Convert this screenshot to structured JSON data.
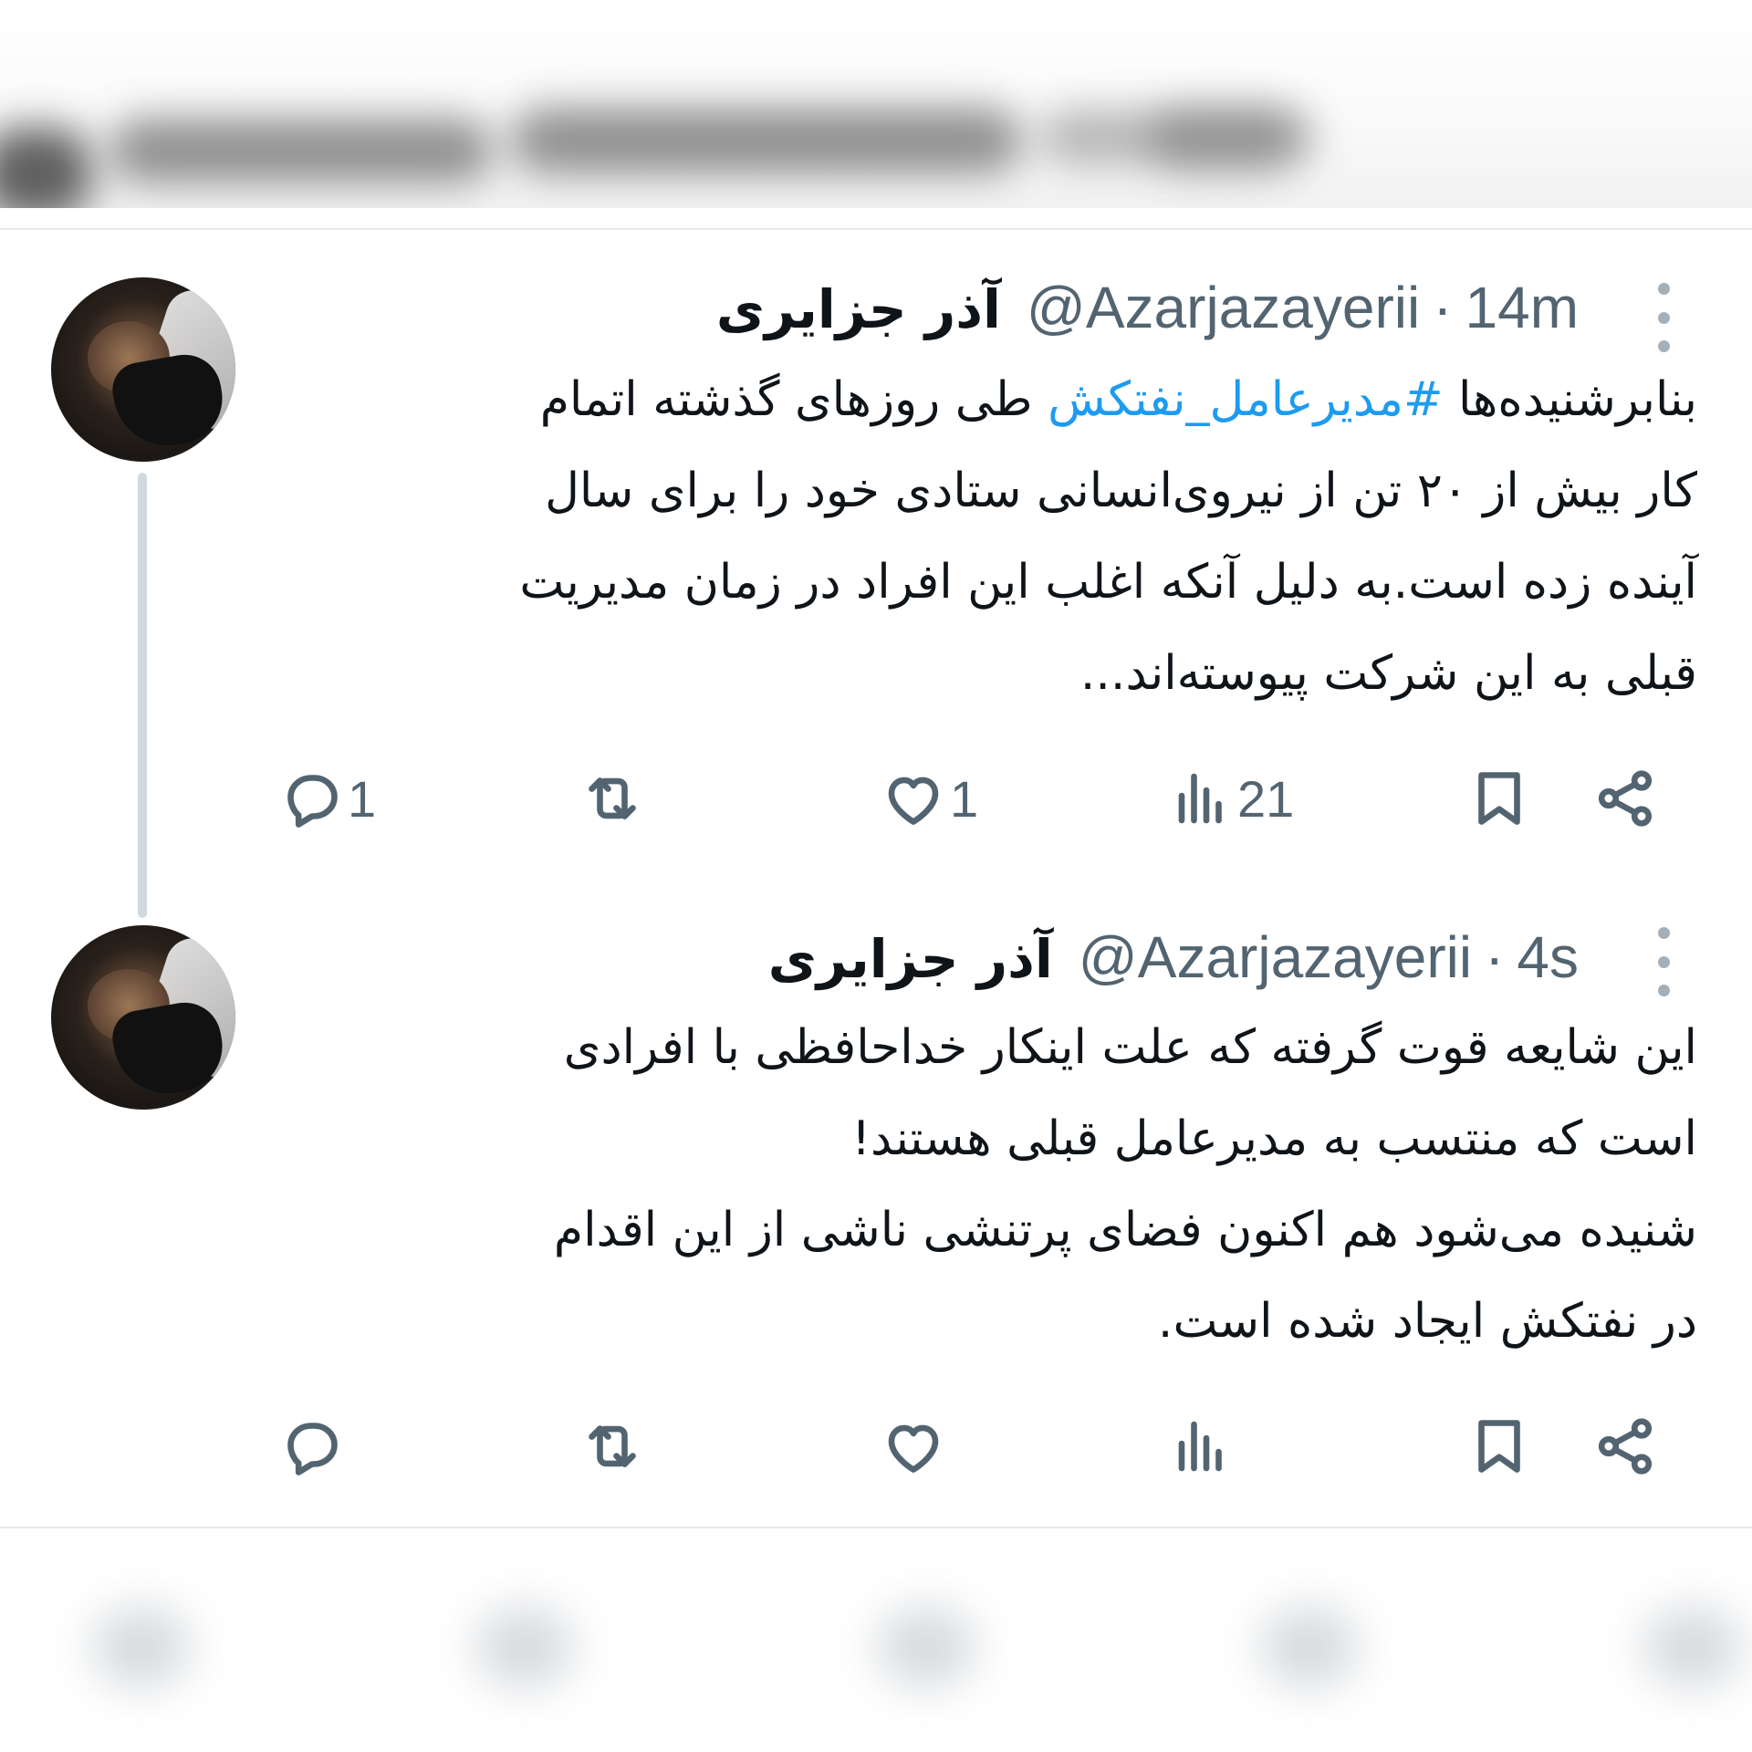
{
  "tweets": [
    {
      "author_name": "آذر جزایری",
      "handle": "@Azarjazayerii",
      "separator": "·",
      "time": "14m",
      "body_lines": [
        {
          "before": "بنابرشنیده‌ها ",
          "hashtag": "#مدیرعامل_نفتکش",
          "after": " طی روزهای گذشته اتمام"
        },
        {
          "before": "کار بیش از ۲۰ تن از نیروی‌انسانی ستادی خود را برای سال",
          "hashtag": "",
          "after": ""
        },
        {
          "before": "آینده زده است.به دلیل آنکه اغلب این افراد در زمان مدیریت",
          "hashtag": "",
          "after": ""
        },
        {
          "before": "قبلی به این شرکت پیوسته‌اند...",
          "hashtag": "",
          "after": ""
        }
      ],
      "replies": "1",
      "retweets": "",
      "likes": "1",
      "views": "21",
      "icons": [
        "reply-icon",
        "retweet-icon",
        "like-icon",
        "views-icon",
        "bookmark-icon",
        "share-icon"
      ]
    },
    {
      "author_name": "آذر جزایری",
      "handle": "@Azarjazayerii",
      "separator": "·",
      "time": "4s",
      "body_lines": [
        {
          "before": "این شایعه قوت گرفته که علت اینکار خداحافظی با افرادی",
          "hashtag": "",
          "after": ""
        },
        {
          "before": "است که منتسب به مدیرعامل قبلی هستند!",
          "hashtag": "",
          "after": ""
        },
        {
          "before": "شنیده می‌شود هم اکنون فضای پرتنشی ناشی از این اقدام",
          "hashtag": "",
          "after": ""
        },
        {
          "before": "در نفتکش ایجاد شده است.",
          "hashtag": "",
          "after": ""
        }
      ],
      "replies": "",
      "retweets": "",
      "likes": "",
      "views": "",
      "icons": [
        "reply-icon",
        "retweet-icon",
        "like-icon",
        "views-icon",
        "bookmark-icon",
        "share-icon"
      ]
    }
  ],
  "colors": {
    "text": "#0f1419",
    "secondary": "#536471",
    "hashtag": "#1d9bf0",
    "thread_line": "#cfd9de",
    "divider": "#e6e9ec"
  }
}
